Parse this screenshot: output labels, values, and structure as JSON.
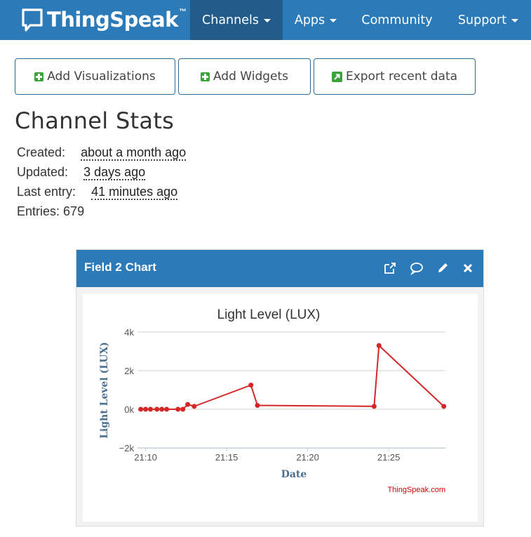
{
  "navbar": {
    "brand": "ThingSpeak",
    "brand_tm": "™",
    "items": [
      {
        "label": "Channels"
      },
      {
        "label": "Apps"
      },
      {
        "label": "Community"
      },
      {
        "label": "Support"
      }
    ]
  },
  "buttons": {
    "add_visualizations": "Add Visualizations",
    "add_widgets": "Add Widgets",
    "export_recent_data": "Export recent data"
  },
  "stats": {
    "title": "Channel Stats",
    "created_label": "Created:",
    "created_value": "about a month ago",
    "updated_label": "Updated:",
    "updated_value": "3 days ago",
    "last_entry_label": "Last entry:",
    "last_entry_value": "41 minutes ago",
    "entries_label": "Entries:",
    "entries_value": "679"
  },
  "widget": {
    "title": "Field 2 Chart",
    "icons": [
      "external-link-icon",
      "comment-icon",
      "pencil-icon",
      "close-icon"
    ],
    "credit": "ThingSpeak.com"
  },
  "colors": {
    "brand": "#2c7ab8",
    "nav_active": "#215c8b",
    "series": "#d62728",
    "credit": "#cc0000",
    "axis_text": "#4a6e8e"
  },
  "chart_data": {
    "type": "line",
    "title": "Light Level (LUX)",
    "xlabel": "Date",
    "ylabel": "Light Level (LUX)",
    "x_ticks": [
      "21:10",
      "21:15",
      "21:20",
      "21:25"
    ],
    "y_ticks": [
      "4k",
      "2k",
      "0k",
      "−2k"
    ],
    "xlim": [
      "21:09.5",
      "21:28.5"
    ],
    "ylim": [
      -2000,
      4000
    ],
    "grid": true,
    "series": [
      {
        "points": [
          {
            "x": "21:09.7",
            "y": 0
          },
          {
            "x": "21:10.0",
            "y": 0
          },
          {
            "x": "21:10.3",
            "y": 0
          },
          {
            "x": "21:10.7",
            "y": 0
          },
          {
            "x": "21:11.0",
            "y": 0
          },
          {
            "x": "21:11.3",
            "y": 0
          },
          {
            "x": "21:12.0",
            "y": 0
          },
          {
            "x": "21:12.3",
            "y": 0
          },
          {
            "x": "21:12.6",
            "y": 250
          },
          {
            "x": "21:13.0",
            "y": 150
          },
          {
            "x": "21:16.5",
            "y": 1250
          },
          {
            "x": "21:16.9",
            "y": 200
          },
          {
            "x": "21:24.1",
            "y": 150
          },
          {
            "x": "21:24.4",
            "y": 3300
          },
          {
            "x": "21:28.4",
            "y": 150
          }
        ]
      }
    ]
  }
}
